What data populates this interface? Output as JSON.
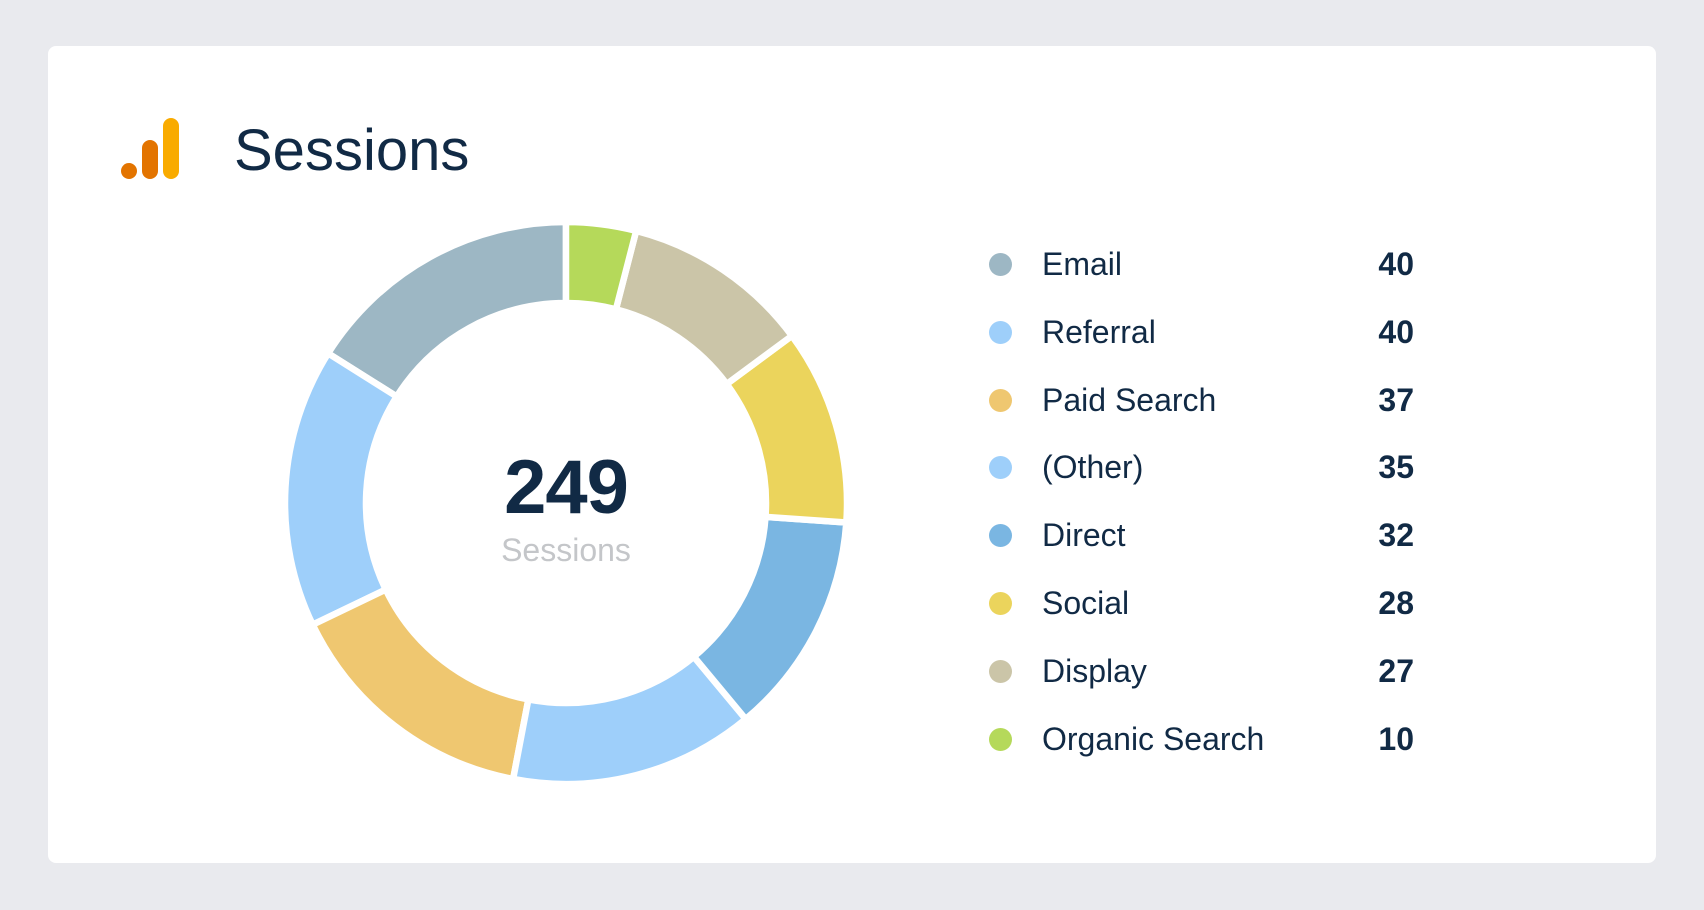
{
  "widget": {
    "title": "Sessions",
    "icon": "google-analytics-icon",
    "icon_colors": {
      "dot": "#e37400",
      "mid_bar": "#e37400",
      "tall_bar": "#f9ab00"
    },
    "background_color": "#e9eaee",
    "card_color": "#ffffff",
    "text_color": "#112a45"
  },
  "center": {
    "total": "249",
    "label": "Sessions"
  },
  "chart_data": {
    "type": "pie",
    "variant": "donut",
    "title": "Sessions",
    "total": 249,
    "center_label": "Sessions",
    "start_angle": "12 o'clock",
    "direction": "counterclockwise-from-legend-order",
    "legend_position": "right",
    "categories": [
      "Email",
      "Referral",
      "Paid Search",
      "(Other)",
      "Direct",
      "Social",
      "Display",
      "Organic Search"
    ],
    "values": [
      40,
      40,
      37,
      35,
      32,
      28,
      27,
      10
    ],
    "colors": [
      "#9db7c4",
      "#9ecffa",
      "#efc770",
      "#9ecffa",
      "#7ab6e2",
      "#ebd45c",
      "#cbc5a8",
      "#b5d95a"
    ],
    "legend": [
      {
        "label": "Email",
        "value": "40",
        "color": "#9db7c4"
      },
      {
        "label": "Referral",
        "value": "40",
        "color": "#9ecffa"
      },
      {
        "label": "Paid Search",
        "value": "37",
        "color": "#efc770"
      },
      {
        "label": "(Other)",
        "value": "35",
        "color": "#9ecffa"
      },
      {
        "label": "Direct",
        "value": "32",
        "color": "#7ab6e2"
      },
      {
        "label": "Social",
        "value": "28",
        "color": "#ebd45c"
      },
      {
        "label": "Display",
        "value": "27",
        "color": "#cbc5a8"
      },
      {
        "label": "Organic Search",
        "value": "10",
        "color": "#b5d95a"
      }
    ]
  }
}
